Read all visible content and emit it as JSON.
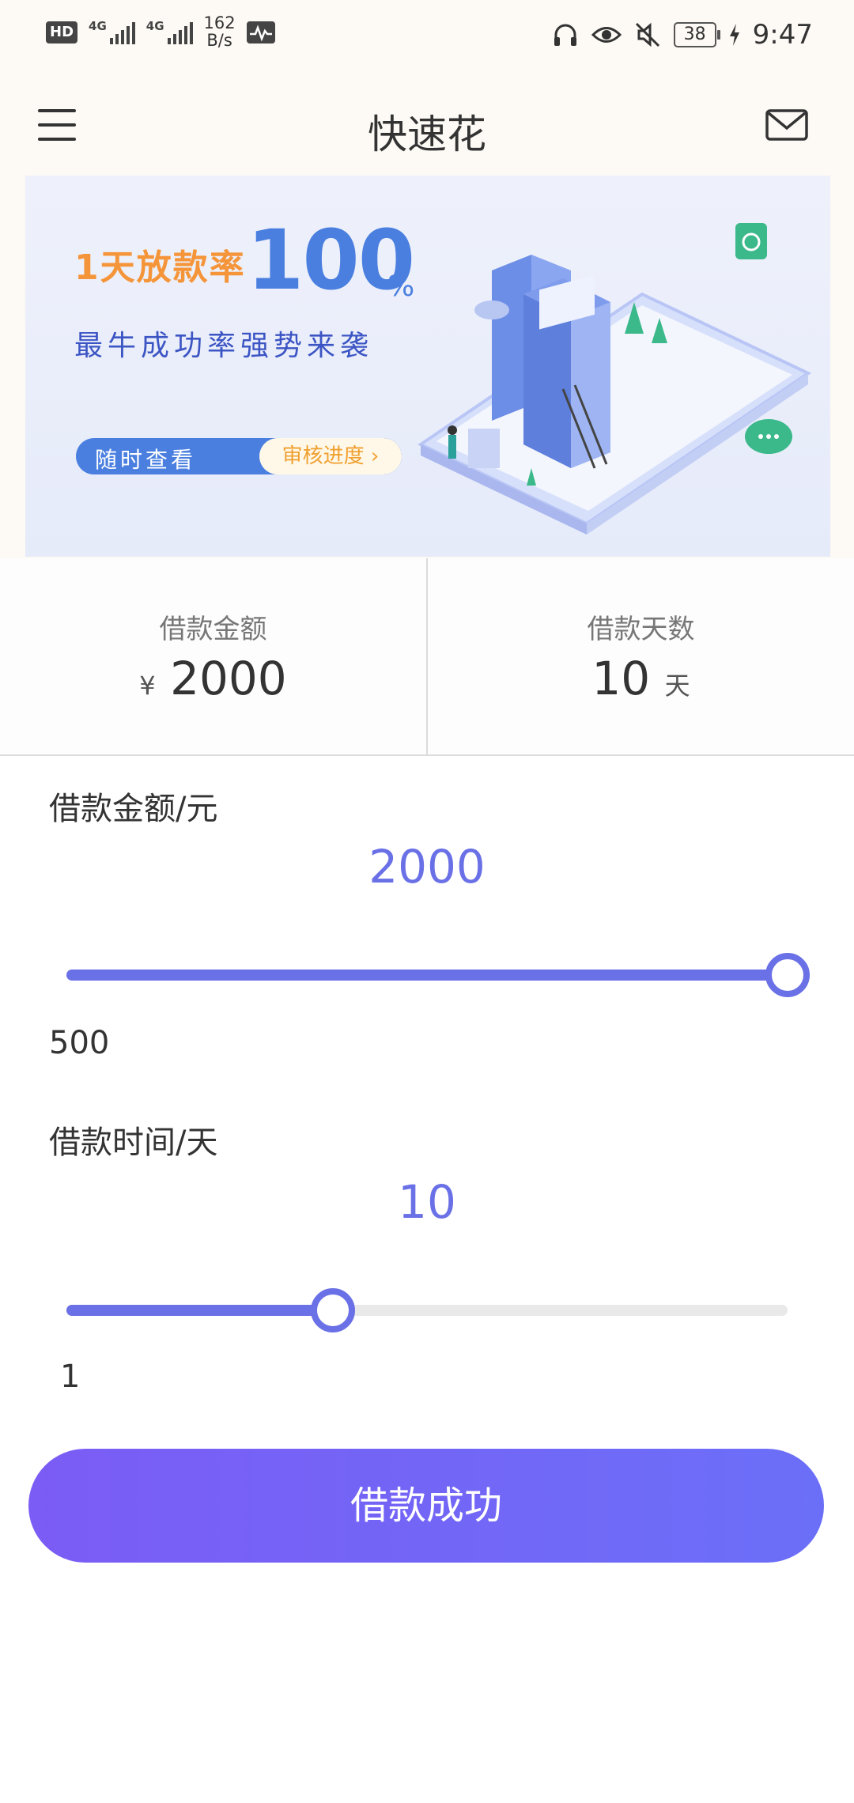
{
  "status_bar": {
    "hd": "HD",
    "network1": "4G",
    "network2": "4G",
    "speed_value": "162",
    "speed_unit": "B/s",
    "battery": "38",
    "time": "9:47"
  },
  "nav": {
    "title": "快速花"
  },
  "banner": {
    "line1": "1天放款率",
    "big_number": "100",
    "percent": "%",
    "line2": "最牛成功率强势来袭",
    "pill_left": "随时查看",
    "pill_right": "审核进度 ›"
  },
  "summary": {
    "amount_label": "借款金额",
    "currency": "¥",
    "amount_value": "2000",
    "days_label": "借款天数",
    "days_value": "10",
    "days_unit": "天"
  },
  "amount_slider": {
    "label": "借款金额/元",
    "value": "2000",
    "min_label": "500",
    "fill_fraction": 1.0
  },
  "days_slider": {
    "label": "借款时间/天",
    "value": "10",
    "min_label": "1",
    "fill_fraction": 0.37
  },
  "submit_button": "借款成功",
  "colors": {
    "accent": "#6a70e6",
    "button_start": "#7b5cf5",
    "button_end": "#6b6ff8"
  }
}
